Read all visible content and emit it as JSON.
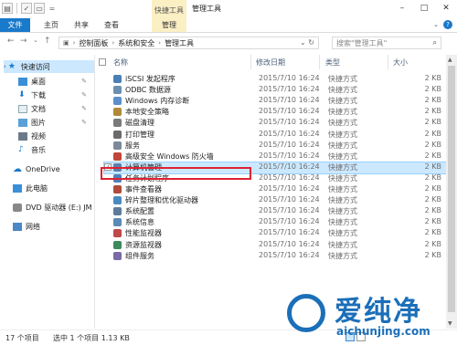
{
  "window": {
    "title": "管理工具",
    "ribbon_context_group": "快捷工具"
  },
  "ribbon": {
    "tabs": [
      {
        "label": "文件"
      },
      {
        "label": "主页"
      },
      {
        "label": "共享"
      },
      {
        "label": "查看"
      },
      {
        "label": "管理"
      }
    ]
  },
  "address": {
    "segments": [
      "控制面板",
      "系统和安全",
      "管理工具"
    ]
  },
  "search": {
    "placeholder": "搜索\"管理工具\""
  },
  "sidebar": {
    "items": [
      {
        "label": "快速访问",
        "icon": "star-icon"
      },
      {
        "label": "桌面",
        "icon": "desktop-icon"
      },
      {
        "label": "下载",
        "icon": "download-icon"
      },
      {
        "label": "文档",
        "icon": "document-icon"
      },
      {
        "label": "图片",
        "icon": "picture-icon"
      },
      {
        "label": "视频",
        "icon": "video-icon"
      },
      {
        "label": "音乐",
        "icon": "music-icon"
      },
      {
        "label": "OneDrive",
        "icon": "cloud-icon"
      },
      {
        "label": "此电脑",
        "icon": "computer-icon"
      },
      {
        "label": "DVD 驱动器 (E:) JM",
        "icon": "dvd-icon"
      },
      {
        "label": "网络",
        "icon": "network-icon"
      }
    ]
  },
  "columns": {
    "name": "名称",
    "date": "修改日期",
    "type": "类型",
    "size": "大小"
  },
  "files": [
    {
      "name": "iSCSI 发起程序",
      "date": "2015/7/10 16:24",
      "type": "快捷方式",
      "size": "2 KB",
      "color": "#4a7fb5"
    },
    {
      "name": "ODBC 数据源",
      "date": "2015/7/10 16:24",
      "type": "快捷方式",
      "size": "2 KB",
      "color": "#6a8fb0"
    },
    {
      "name": "Windows 内存诊断",
      "date": "2015/7/10 16:24",
      "type": "快捷方式",
      "size": "2 KB",
      "color": "#5b8fc9"
    },
    {
      "name": "本地安全策略",
      "date": "2015/7/10 16:24",
      "type": "快捷方式",
      "size": "2 KB",
      "color": "#b08a3a"
    },
    {
      "name": "磁盘清理",
      "date": "2015/7/10 16:24",
      "type": "快捷方式",
      "size": "2 KB",
      "color": "#7a7a7a"
    },
    {
      "name": "打印管理",
      "date": "2015/7/10 16:24",
      "type": "快捷方式",
      "size": "2 KB",
      "color": "#6b6b6b"
    },
    {
      "name": "服务",
      "date": "2015/7/10 16:24",
      "type": "快捷方式",
      "size": "2 KB",
      "color": "#7c8a9a"
    },
    {
      "name": "高级安全 Windows 防火墙",
      "date": "2015/7/10 16:24",
      "type": "快捷方式",
      "size": "2 KB",
      "color": "#c0463a"
    },
    {
      "name": "计算机管理",
      "date": "2015/7/10 16:24",
      "type": "快捷方式",
      "size": "2 KB",
      "color": "#5a7fa8",
      "selected": true
    },
    {
      "name": "任务计划程序",
      "date": "2015/7/10 16:24",
      "type": "快捷方式",
      "size": "2 KB",
      "color": "#4f7fb8"
    },
    {
      "name": "事件查看器",
      "date": "2015/7/10 16:24",
      "type": "快捷方式",
      "size": "2 KB",
      "color": "#b04a3a"
    },
    {
      "name": "碎片整理和优化驱动器",
      "date": "2015/7/10 16:24",
      "type": "快捷方式",
      "size": "2 KB",
      "color": "#4a8ac0"
    },
    {
      "name": "系统配置",
      "date": "2015/7/10 16:24",
      "type": "快捷方式",
      "size": "2 KB",
      "color": "#5d7c99"
    },
    {
      "name": "系统信息",
      "date": "2015/7/10 16:24",
      "type": "快捷方式",
      "size": "2 KB",
      "color": "#5a8ab6"
    },
    {
      "name": "性能监视器",
      "date": "2015/7/10 16:24",
      "type": "快捷方式",
      "size": "2 KB",
      "color": "#c04848"
    },
    {
      "name": "资源监视器",
      "date": "2015/7/10 16:24",
      "type": "快捷方式",
      "size": "2 KB",
      "color": "#3d8a5c"
    },
    {
      "name": "组件服务",
      "date": "2015/7/10 16:24",
      "type": "快捷方式",
      "size": "2 KB",
      "color": "#7a6aa8"
    }
  ],
  "status": {
    "count": "17 个项目",
    "selection": "选中 1 个项目  1.13 KB"
  },
  "watermark": {
    "brand": "爱纯净",
    "url": "aichunjing.com"
  },
  "colors": {
    "accent": "#1979ca",
    "context_tab": "#fbefc4",
    "selection": "#cce8ff",
    "highlight": "#dd2233"
  }
}
